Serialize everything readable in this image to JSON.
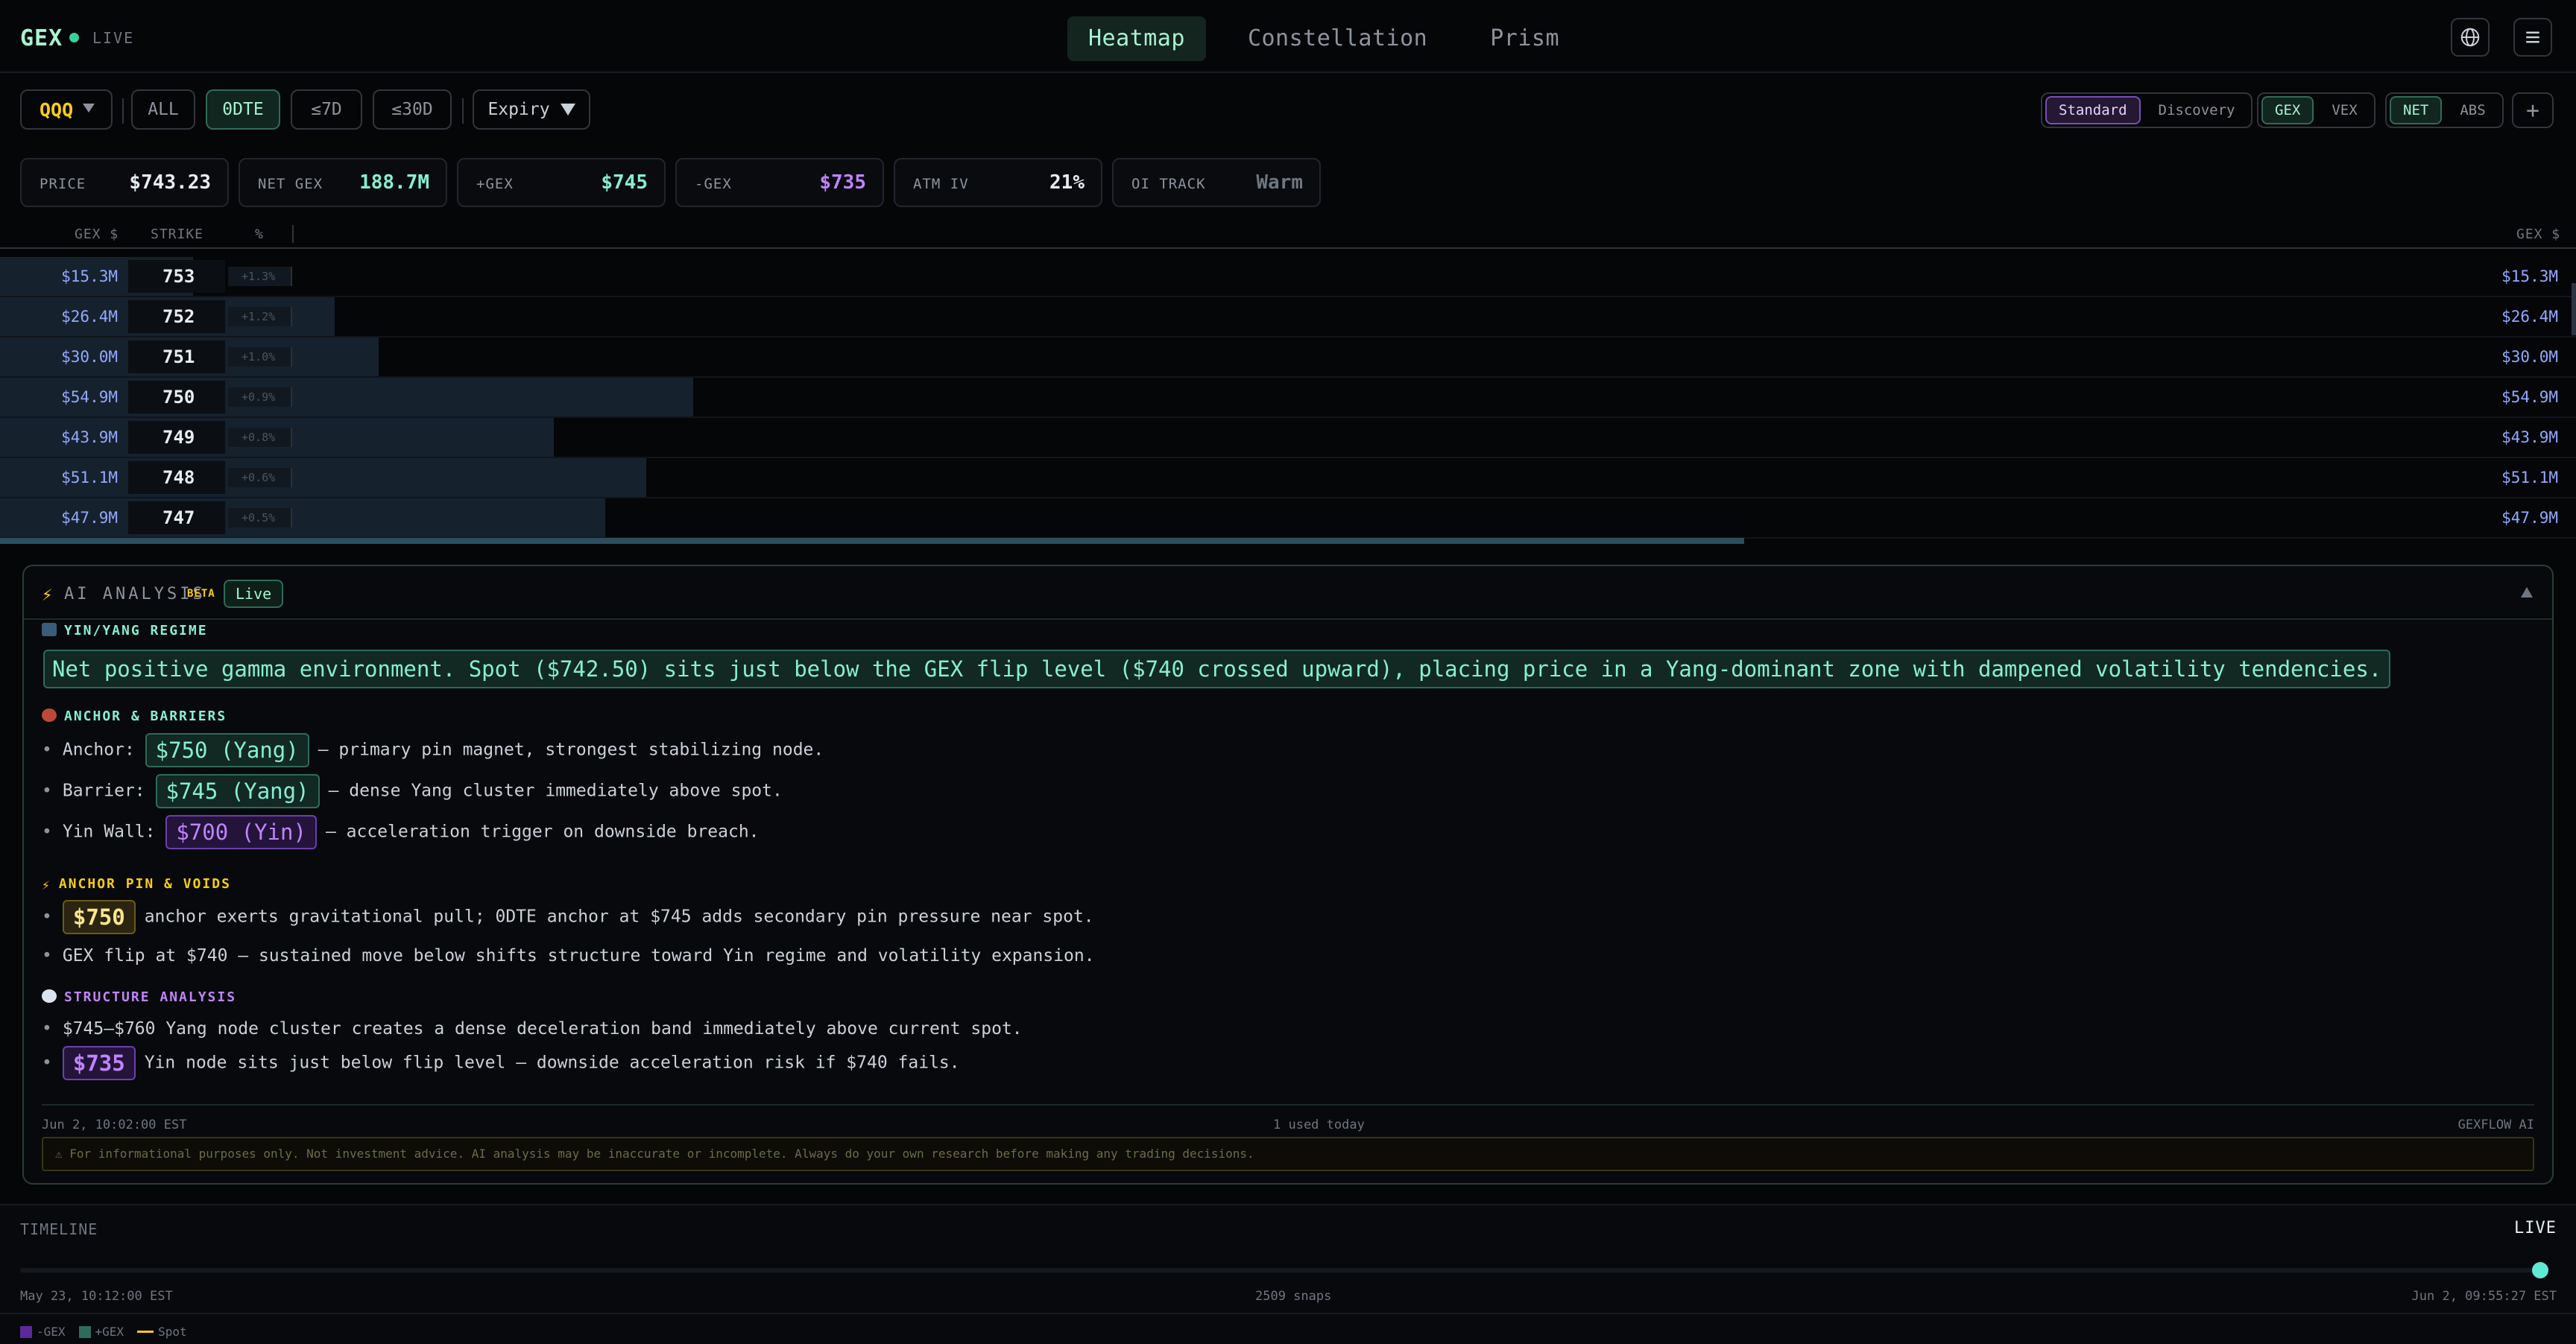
{
  "nav": {
    "brand": "GEX",
    "live": "LIVE",
    "tabs": [
      "Heatmap",
      "Constellation",
      "Prism"
    ],
    "globe_icon": "globe-icon",
    "menu_icon": "menu-icon"
  },
  "filters": {
    "ticker": "QQQ",
    "ranges": [
      "ALL",
      "0DTE",
      "≤7D",
      "≤30D"
    ],
    "active_range": "0DTE",
    "expiry": "Expiry",
    "mode": [
      "Standard",
      "Discovery"
    ],
    "metric": [
      "GEX",
      "VEX"
    ],
    "view": [
      "NET",
      "ABS"
    ],
    "add": "+"
  },
  "stats": [
    {
      "label": "PRICE",
      "value": "$743.23",
      "color": "#e6edf3"
    },
    {
      "label": "NET GEX",
      "value": "188.7M",
      "color": "#86efd0"
    },
    {
      "label": "+GEX",
      "value": "$745",
      "color": "#86efd0"
    },
    {
      "label": "-GEX",
      "value": "$735",
      "color": "#c084fc"
    },
    {
      "label": "ATM IV",
      "value": "21%",
      "color": "#e6edf3"
    },
    {
      "label": "OI TRACK",
      "value": "Warm",
      "color": "#6e7681"
    }
  ],
  "heatmap": {
    "headers": {
      "gex_left": "GEX $",
      "strike": "STRIKE",
      "pct": "%",
      "gex_right": "GEX $"
    },
    "rows": [
      {
        "gex": "$15.3M",
        "strike": "753",
        "pct": "+1.3%",
        "fill": 0.075
      },
      {
        "gex": "$26.4M",
        "strike": "752",
        "pct": "+1.2%",
        "fill": 0.13
      },
      {
        "gex": "$30.0M",
        "strike": "751",
        "pct": "+1.0%",
        "fill": 0.147
      },
      {
        "gex": "$54.9M",
        "strike": "750",
        "pct": "+0.9%",
        "fill": 0.269
      },
      {
        "gex": "$43.9M",
        "strike": "749",
        "pct": "+0.8%",
        "fill": 0.215
      },
      {
        "gex": "$51.1M",
        "strike": "748",
        "pct": "+0.6%",
        "fill": 0.251
      },
      {
        "gex": "$47.9M",
        "strike": "747",
        "pct": "+0.5%",
        "fill": 0.235
      }
    ]
  },
  "ai": {
    "title": "AI ANALYSIS",
    "beta": "BETA",
    "badge": "Live",
    "sections": {
      "regime": "YIN/YANG REGIME",
      "anchor": "ANCHOR & BARRIERS",
      "pin": "ANCHOR PIN & VOIDS",
      "structure": "STRUCTURE ANALYSIS"
    },
    "headline": "Net positive gamma environment. Spot ($742.50) sits just below the GEX flip level ($740 crossed upward), placing price in a Yang-dominant zone with dampened volatility tendencies.",
    "anchor_lines": [
      {
        "label": "Anchor:",
        "chip": "$750 (Yang)",
        "text": "— primary pin magnet, strongest stabilizing node."
      },
      {
        "label": "Barrier:",
        "chip": "$745 (Yang)",
        "text": "— dense Yang cluster immediately above spot."
      },
      {
        "label": "Yin Wall:",
        "chip": "$700 (Yin)",
        "text": "— acceleration trigger on downside breach."
      }
    ],
    "pin_lines": [
      {
        "chip": "$750",
        "text": "anchor exerts gravitational pull; 0DTE anchor at $745 adds secondary pin pressure near spot."
      },
      {
        "text": "GEX flip at $740 — sustained move below shifts structure toward Yin regime and volatility expansion."
      }
    ],
    "structure_lines": [
      {
        "text": "$745–$760 Yang node cluster creates a dense deceleration band immediately above current spot."
      },
      {
        "chip": "$735",
        "text": "Yin node sits just below flip level — downside acceleration risk if $740 fails."
      }
    ],
    "bullet": "•",
    "timestamp": "Jun 2, 10:02:00 EST",
    "usage": "1 used today",
    "source": "GEXFLOW AI",
    "disclaimer": "⚠ For informational purposes only. Not investment advice. AI analysis may be inaccurate or incomplete. Always do your own research before making any trading decisions."
  },
  "timeline": {
    "label": "TIMELINE",
    "live": "LIVE",
    "start": "May 23, 10:12:00 EST",
    "snaps": "2509 snaps",
    "end": "Jun 2, 09:55:27 EST",
    "position": 1.0,
    "legend": [
      "-GEX",
      "+GEX",
      "Spot"
    ]
  }
}
